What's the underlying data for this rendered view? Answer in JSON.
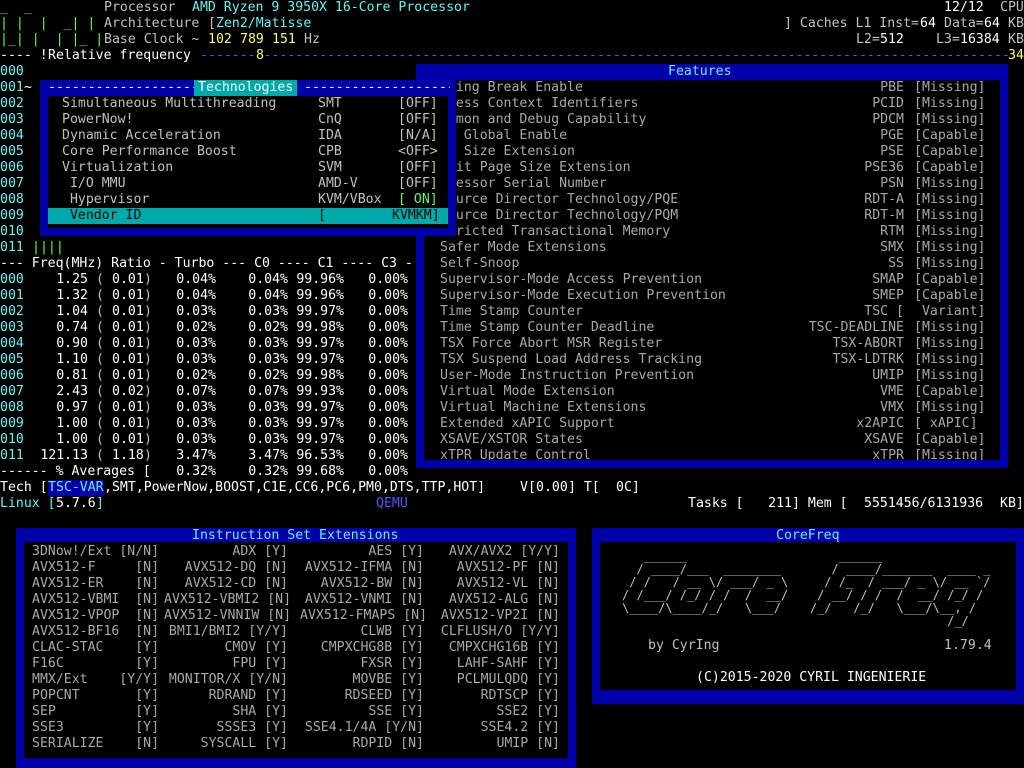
{
  "header": {
    "processor_label": "Processor",
    "processor_value": "AMD Ryzen 9 3950X 16-Core Processor",
    "cpu_count": "12/12",
    "cpu_label": "CPU",
    "arch_label": "Architecture",
    "arch_value": "Zen2/Matisse",
    "caches_label": "] Caches L1 Inst=",
    "l1_inst": "64",
    "data_label": "Data=",
    "l1_data": "64",
    "kb": "KB",
    "base_clock_label": "Base Clock ~",
    "base_clock_1": "102",
    "base_clock_2": "789",
    "base_clock_3": "151",
    "hz": "Hz",
    "l2_label": "L2=",
    "l2": "512",
    "l3_label": "L3=",
    "l3": "16384",
    "relfreq": "Relative frequency",
    "relfreq_mark1": "8",
    "relfreq_mark2": "34"
  },
  "tech_popup": {
    "title": "Technologies",
    "rows": [
      {
        "name": "Simultaneous Multithreading",
        "abbr": "SMT",
        "value": "[OFF]"
      },
      {
        "name": "PowerNow!",
        "abbr": "CnQ",
        "value": "[OFF]"
      },
      {
        "name": "Dynamic Acceleration",
        "abbr": "IDA",
        "value": "[N/A]"
      },
      {
        "name": "Core Performance Boost",
        "abbr": "CPB",
        "value": "<OFF>"
      },
      {
        "name": "Virtualization",
        "abbr": "SVM",
        "value": "[OFF]"
      },
      {
        "name": " I/O MMU",
        "abbr": "AMD-V",
        "value": "[OFF]"
      },
      {
        "name": " Hypervisor",
        "abbr": "KVM/VBox",
        "value": "[ ON]"
      },
      {
        "name": " Vendor ID",
        "abbr": "[",
        "value": "KVMKM]"
      }
    ]
  },
  "features": {
    "title": "Features",
    "rows": [
      {
        "name": "nding Break Enable",
        "abbr": "PBE",
        "value": "[Missing]"
      },
      {
        "name": "ocess Context Identifiers",
        "abbr": "PCID",
        "value": "[Missing]"
      },
      {
        "name": "rfmon and Debug Capability",
        "abbr": "PDCM",
        "value": "[Missing]"
      },
      {
        "name": "ge Global Enable",
        "abbr": "PGE",
        "value": "[Capable]"
      },
      {
        "name": "ge Size Extension",
        "abbr": "PSE",
        "value": "[Capable]"
      },
      {
        "name": "-bit Page Size Extension",
        "abbr": "PSE36",
        "value": "[Capable]"
      },
      {
        "name": "ocessor Serial Number",
        "abbr": "PSN",
        "value": "[Missing]"
      },
      {
        "name": "source Director Technology/PQE",
        "abbr": "RDT-A",
        "value": "[Missing]"
      },
      {
        "name": "source Director Technology/PQM",
        "abbr": "RDT-M",
        "value": "[Missing]"
      },
      {
        "name": "stricted Transactional Memory",
        "abbr": "RTM",
        "value": "[Missing]"
      },
      {
        "name": "Safer Mode Extensions",
        "abbr": "SMX",
        "value": "[Missing]"
      },
      {
        "name": "Self-Snoop",
        "abbr": "SS",
        "value": "[Missing]"
      },
      {
        "name": "Supervisor-Mode Access Prevention",
        "abbr": "SMAP",
        "value": "[Capable]"
      },
      {
        "name": "Supervisor-Mode Execution Prevention",
        "abbr": "SMEP",
        "value": "[Capable]"
      },
      {
        "name": "Time Stamp Counter",
        "abbr": "TSC [",
        "value": " Variant]"
      },
      {
        "name": "Time Stamp Counter Deadline",
        "abbr": "TSC-DEADLINE",
        "value": "[Missing]"
      },
      {
        "name": "TSX Force Abort MSR Register",
        "abbr": "TSX-ABORT",
        "value": "[Missing]"
      },
      {
        "name": "TSX Suspend Load Address Tracking",
        "abbr": "TSX-LDTRK",
        "value": "[Missing]"
      },
      {
        "name": "User-Mode Instruction Prevention",
        "abbr": "UMIP",
        "value": "[Missing]"
      },
      {
        "name": "Virtual Mode Extension",
        "abbr": "VME",
        "value": "[Capable]"
      },
      {
        "name": "Virtual Machine Extensions",
        "abbr": "VMX",
        "value": "[Missing]"
      },
      {
        "name": "Extended xAPIC Support",
        "abbr": "x2APIC",
        "value": "[ xAPIC]"
      },
      {
        "name": "XSAVE/XSTOR States",
        "abbr": "XSAVE",
        "value": "[Capable]"
      },
      {
        "name": "xTPR Update Control",
        "abbr": "xTPR",
        "value": "[Missing]"
      }
    ]
  },
  "cores_ids": [
    "000",
    "001",
    "002",
    "003",
    "004",
    "005",
    "006",
    "007",
    "008",
    "009",
    "010",
    "011"
  ],
  "core001_mark": "~",
  "core011_bars": "||||",
  "freq_header": "--- Freq(MHz) Ratio - Turbo --- C0 ---- C1 ---- C3 -",
  "freq_rows": [
    {
      "id": "000",
      "freq": "1.25",
      "ratio": "0.01",
      "turbo": "0.04%",
      "c0": "0.04%",
      "c1": "99.96%",
      "c3": "0.00%"
    },
    {
      "id": "001",
      "freq": "1.32",
      "ratio": "0.01",
      "turbo": "0.04%",
      "c0": "0.04%",
      "c1": "99.96%",
      "c3": "0.00%"
    },
    {
      "id": "002",
      "freq": "1.04",
      "ratio": "0.01",
      "turbo": "0.03%",
      "c0": "0.03%",
      "c1": "99.97%",
      "c3": "0.00%"
    },
    {
      "id": "003",
      "freq": "0.74",
      "ratio": "0.01",
      "turbo": "0.02%",
      "c0": "0.02%",
      "c1": "99.98%",
      "c3": "0.00%"
    },
    {
      "id": "004",
      "freq": "0.90",
      "ratio": "0.01",
      "turbo": "0.03%",
      "c0": "0.03%",
      "c1": "99.97%",
      "c3": "0.00%"
    },
    {
      "id": "005",
      "freq": "1.10",
      "ratio": "0.01",
      "turbo": "0.03%",
      "c0": "0.03%",
      "c1": "99.97%",
      "c3": "0.00%"
    },
    {
      "id": "006",
      "freq": "0.81",
      "ratio": "0.01",
      "turbo": "0.02%",
      "c0": "0.02%",
      "c1": "99.98%",
      "c3": "0.00%"
    },
    {
      "id": "007",
      "freq": "2.43",
      "ratio": "0.02",
      "turbo": "0.07%",
      "c0": "0.07%",
      "c1": "99.93%",
      "c3": "0.00%"
    },
    {
      "id": "008",
      "freq": "0.97",
      "ratio": "0.01",
      "turbo": "0.03%",
      "c0": "0.03%",
      "c1": "99.97%",
      "c3": "0.00%"
    },
    {
      "id": "009",
      "freq": "1.00",
      "ratio": "0.01",
      "turbo": "0.03%",
      "c0": "0.03%",
      "c1": "99.97%",
      "c3": "0.00%"
    },
    {
      "id": "010",
      "freq": "1.00",
      "ratio": "0.01",
      "turbo": "0.03%",
      "c0": "0.03%",
      "c1": "99.97%",
      "c3": "0.00%"
    },
    {
      "id": "011",
      "freq": "121.13",
      "ratio": "1.18",
      "turbo": "3.47%",
      "c0": "3.47%",
      "c1": "96.53%",
      "c3": "0.00%"
    }
  ],
  "averages": {
    "label": "------ % Averages [",
    "turbo": "0.32%",
    "c0": "0.32%",
    "c1": "99.68%",
    "c3": "0.00%"
  },
  "tech_line": {
    "label": "Tech [",
    "first": "TSC-VAR",
    "rest": ",SMT,PowerNow,BOOST,C1E,CC6,PC6,PM0,DTS,TTP,HOT]",
    "v_label": "V[",
    "v_value": "0.00",
    "t_label": "] T[",
    "t_value": "0C]"
  },
  "linux_line": {
    "label": "Linux [",
    "version": "5.7.6",
    "close": "]",
    "qemu": "QEMU",
    "tasks_label": "Tasks [",
    "tasks": "211",
    "mem_label": "] Mem [",
    "mem": "5551456/6131936",
    "kb": "KB]"
  },
  "isa": {
    "title": "Instruction Set Extensions",
    "rows": [
      [
        "3DNow!/Ext [N/N]",
        "ADX [Y]",
        "AES [Y]",
        "AVX/AVX2 [Y/Y]"
      ],
      [
        "AVX512-F     [N]",
        "AVX512-DQ [N]",
        "AVX512-IFMA [N]",
        "AVX512-PF [N]"
      ],
      [
        "AVX512-ER    [N]",
        "AVX512-CD [N]",
        "AVX512-BW [N]",
        "AVX512-VL [N]"
      ],
      [
        "AVX512-VBMI  [N]",
        "AVX512-VBMI2 [N]",
        "AVX512-VNMI [N]",
        "AVX512-ALG [N]"
      ],
      [
        "AVX512-VPOP  [N]",
        "AVX512-VNNIW [N]",
        "AVX512-FMAPS [N]",
        "AVX512-VP2I [N]"
      ],
      [
        "AVX512-BF16  [N]",
        "BMI1/BMI2 [Y/Y]",
        "CLWB [Y]",
        "CLFLUSH/O [Y/Y]"
      ],
      [
        "CLAC-STAC    [Y]",
        "CMOV [Y]",
        "CMPXCHG8B [Y]",
        "CMPXCHG16B [Y]"
      ],
      [
        "F16C         [Y]",
        "FPU [Y]",
        "FXSR [Y]",
        "LAHF-SAHF [Y]"
      ],
      [
        "MMX/Ext    [Y/Y]",
        "MONITOR/X [Y/N]",
        "MOVBE [Y]",
        "PCLMULQDQ [Y]"
      ],
      [
        "POPCNT       [Y]",
        "RDRAND [Y]",
        "RDSEED [Y]",
        "RDTSCP [Y]"
      ],
      [
        "SEP          [Y]",
        "SHA [Y]",
        "SSE [Y]",
        "SSE2 [Y]"
      ],
      [
        "SSE3         [Y]",
        "SSSE3 [Y]",
        "SSE4.1/4A [Y/N]",
        "SSE4.2 [Y]"
      ],
      [
        "SERIALIZE    [N]",
        "SYSCALL [Y]",
        "RDPID [N]",
        "UMIP [N]"
      ]
    ]
  },
  "corefreq": {
    "title": "CoreFreq",
    "author": "by CyrIng",
    "version": "1.79.4",
    "copyright": "(C)2015-2020 CYRIL INGENIERIE"
  }
}
